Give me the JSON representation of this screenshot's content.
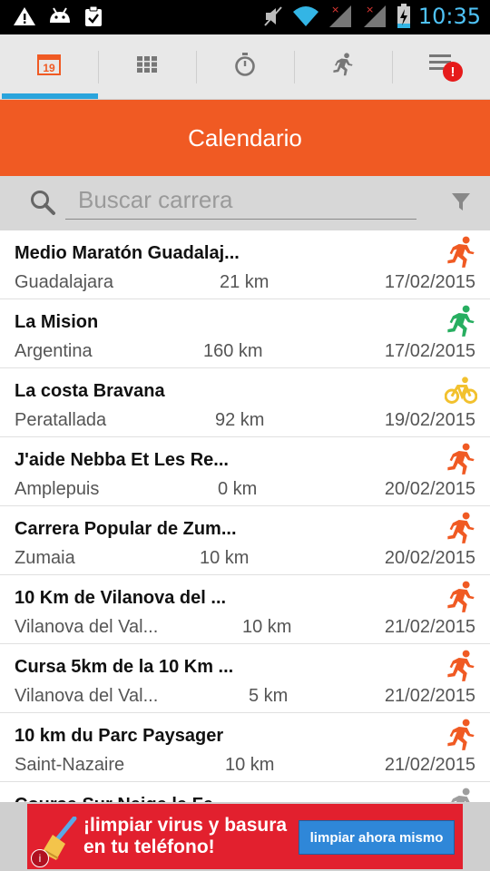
{
  "status_bar": {
    "time": "10:35",
    "left_icons": [
      "warning-icon",
      "android-icon",
      "clipboard-check-icon"
    ],
    "right_icons": [
      "mute-icon",
      "wifi-icon",
      "signal-icon",
      "signal-icon",
      "battery-charging-icon"
    ]
  },
  "tabs": [
    {
      "id": "calendar",
      "icon": "calendar-icon",
      "date_number": "19",
      "active": true
    },
    {
      "id": "grid",
      "icon": "grid-icon",
      "active": false
    },
    {
      "id": "timer",
      "icon": "stopwatch-icon",
      "active": false
    },
    {
      "id": "runner",
      "icon": "runner-icon",
      "active": false
    },
    {
      "id": "notifications",
      "icon": "list-alert-icon",
      "badge": "!",
      "active": false
    }
  ],
  "header": {
    "title": "Calendario"
  },
  "search": {
    "placeholder": "Buscar carrera",
    "value": ""
  },
  "races": [
    {
      "name": "Medio Maratón Guadalaj...",
      "place": "Guadalajara",
      "distance": "21 km",
      "date": "17/02/2015",
      "sport": "running",
      "color": "#f05a23"
    },
    {
      "name": "La Mision",
      "place": "Argentina",
      "distance": "160 km",
      "date": "17/02/2015",
      "sport": "trail-running",
      "color": "#27ae60"
    },
    {
      "name": "La costa Bravana",
      "place": "Peratallada",
      "distance": "92 km",
      "date": "19/02/2015",
      "sport": "cycling",
      "color": "#f2c12e"
    },
    {
      "name": "J'aide Nebba Et Les Re...",
      "place": "Amplepuis",
      "distance": "0 km",
      "date": "20/02/2015",
      "sport": "running",
      "color": "#f05a23"
    },
    {
      "name": "Carrera Popular de Zum...",
      "place": "Zumaia",
      "distance": "10 km",
      "date": "20/02/2015",
      "sport": "running",
      "color": "#f05a23"
    },
    {
      "name": "10 Km de Vilanova del ...",
      "place": "Vilanova del Val...",
      "distance": "10 km",
      "date": "21/02/2015",
      "sport": "running",
      "color": "#f05a23"
    },
    {
      "name": "Cursa 5km de la 10 Km ...",
      "place": "Vilanova del Val...",
      "distance": "5 km",
      "date": "21/02/2015",
      "sport": "running",
      "color": "#f05a23"
    },
    {
      "name": "10 km du Parc Paysager",
      "place": "Saint-Nazaire",
      "distance": "10 km",
      "date": "21/02/2015",
      "sport": "running",
      "color": "#f05a23"
    },
    {
      "name": "Course Sur Neige le Fe...",
      "place": "",
      "distance": "",
      "date": "",
      "sport": "running",
      "color": "#9e9e9e"
    }
  ],
  "ad": {
    "text_line1": "¡limpiar virus y basura",
    "text_line2": "en tu teléfono!",
    "button_label": "limpiar ahora mismo",
    "info_icon": "info-icon"
  },
  "colors": {
    "accent": "#f05a23",
    "tab_indicator": "#2aa4dc",
    "ad_background": "#e2202e",
    "ad_button": "#2f87d8"
  }
}
